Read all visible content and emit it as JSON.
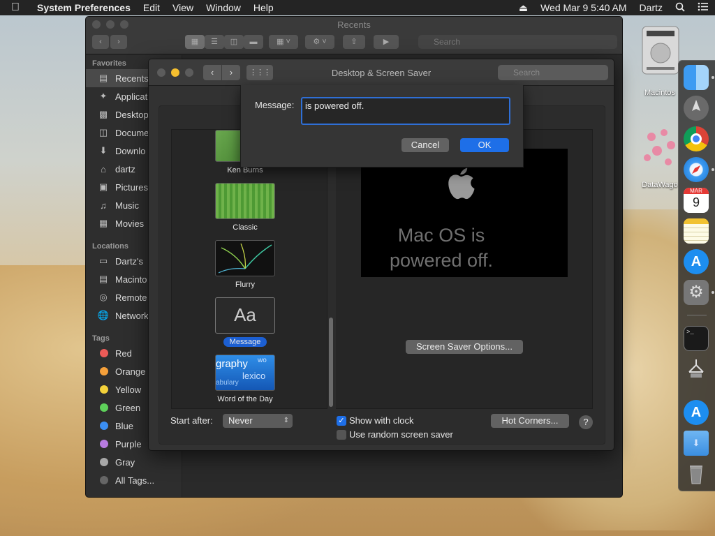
{
  "menubar": {
    "app": "System Preferences",
    "menus": [
      "Edit",
      "View",
      "Window",
      "Help"
    ],
    "datetime": "Wed Mar 9  5:40 AM",
    "user": "Dartz"
  },
  "finder": {
    "title": "Recents",
    "search_placeholder": "Search",
    "sections": {
      "favorites": "Favorites",
      "locations": "Locations",
      "tags": "Tags"
    },
    "favorites": [
      "Recents",
      "Applicat",
      "Desktop",
      "Docume",
      "Downlo",
      "dartz",
      "Pictures",
      "Music",
      "Movies"
    ],
    "locations": [
      "Dartz's",
      "Macinto",
      "Remote",
      "Network"
    ],
    "tags": [
      "Red",
      "Orange",
      "Yellow",
      "Green",
      "Blue",
      "Purple",
      "Gray",
      "All Tags..."
    ]
  },
  "prefs": {
    "title": "Desktop & Screen Saver",
    "search_placeholder": "Search",
    "savers": [
      "Ken Burns",
      "Classic",
      "Flurry",
      "Message",
      "Word of the Day"
    ],
    "selected_saver": "Message",
    "aa": "Aa",
    "wotd_words": [
      "graphy",
      "lexico",
      "abulary",
      "wo"
    ],
    "preview_message": "Mac OS is powered off.",
    "options_button": "Screen Saver Options...",
    "start_after_label": "Start after:",
    "start_after_value": "Never",
    "show_clock_label": "Show with clock",
    "show_clock_checked": true,
    "random_label": "Use random screen saver",
    "random_checked": false,
    "hot_corners": "Hot Corners...",
    "help": "?"
  },
  "sheet": {
    "label": "Message:",
    "value": "is powered off.",
    "cancel": "Cancel",
    "ok": "OK"
  },
  "desktop": {
    "icons": [
      "Macintos",
      "DataWago"
    ]
  },
  "dock": {
    "calendar_month": "MAR",
    "calendar_day": "9"
  },
  "colors": {
    "accent": "#1e6fe8",
    "tag_red": "#ec5b57",
    "tag_orange": "#f5a03a",
    "tag_yellow": "#f3d13a",
    "tag_green": "#5ed05a",
    "tag_blue": "#3b8ff3",
    "tag_purple": "#b77be0",
    "tag_gray": "#a8a8a8"
  }
}
